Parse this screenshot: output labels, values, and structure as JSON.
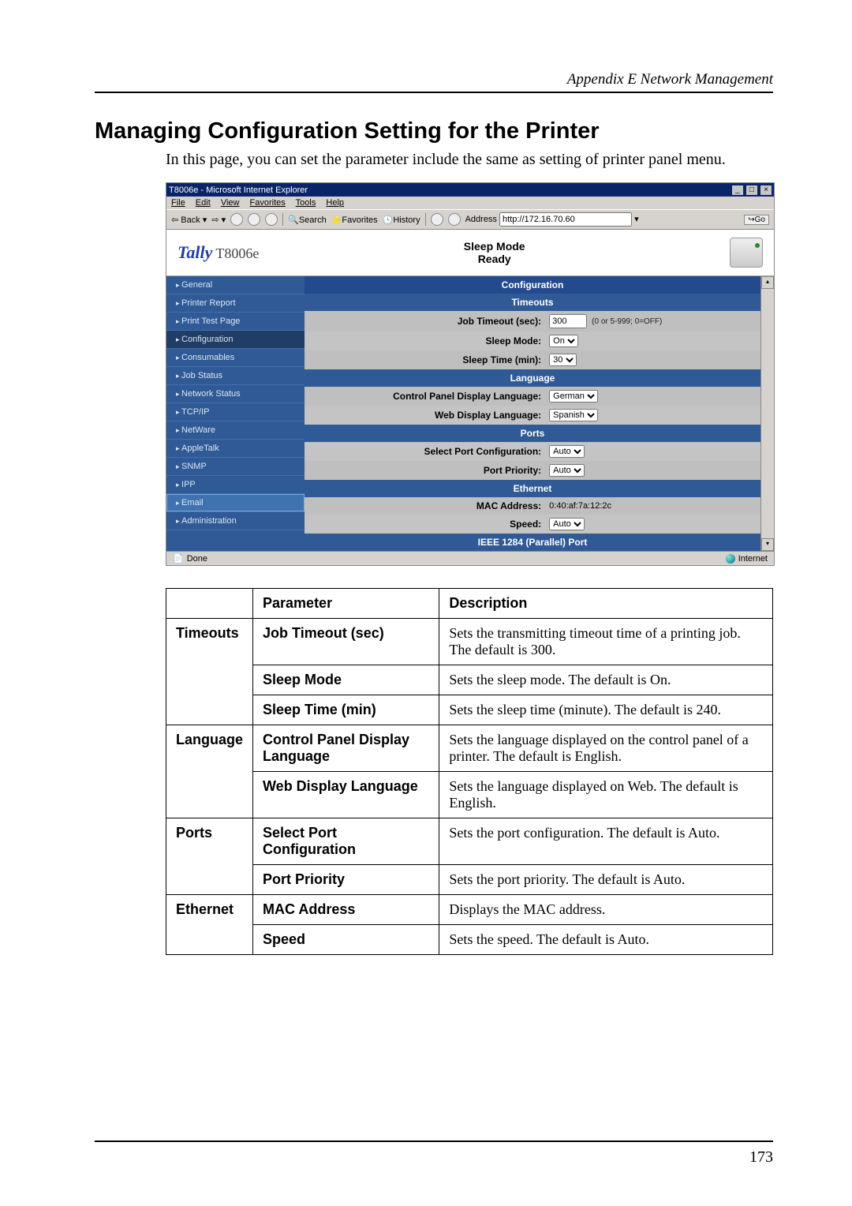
{
  "header": {
    "appendix": "Appendix E Network Management",
    "title": "Managing Configuration Setting for the Printer",
    "intro": "In this page, you can set the parameter include the same as setting of printer panel menu."
  },
  "page_number": "173",
  "screenshot": {
    "window_title": "T8006e - Microsoft Internet Explorer",
    "menus": [
      "File",
      "Edit",
      "View",
      "Favorites",
      "Tools",
      "Help"
    ],
    "toolbar": {
      "back": "Back",
      "search": "Search",
      "favorites": "Favorites",
      "history": "History",
      "address_label": "Address",
      "address_value": "http://172.16.70.60",
      "go": "Go"
    },
    "logo_brand": "Tally",
    "logo_model": "T8006e",
    "status_line1": "Sleep Mode",
    "status_line2": "Ready",
    "sidebar": [
      "General",
      "Printer Report",
      "Print Test Page",
      "Configuration",
      "Consumables",
      "Job Status",
      "Network Status",
      "TCP/IP",
      "NetWare",
      "AppleTalk",
      "SNMP",
      "IPP",
      "Email",
      "Administration"
    ],
    "groups": {
      "configuration": "Configuration",
      "timeouts": "Timeouts",
      "language": "Language",
      "ports": "Ports",
      "ethernet": "Ethernet",
      "parallel": "IEEE 1284 (Parallel) Port"
    },
    "fields": {
      "job_timeout_label": "Job Timeout (sec):",
      "job_timeout_value": "300",
      "job_timeout_hint": "(0 or 5-999; 0=OFF)",
      "sleep_mode_label": "Sleep Mode:",
      "sleep_mode_value": "On",
      "sleep_time_label": "Sleep Time (min):",
      "sleep_time_value": "30",
      "cp_lang_label": "Control Panel Display Language:",
      "cp_lang_value": "German",
      "web_lang_label": "Web Display Language:",
      "web_lang_value": "Spanish",
      "port_conf_label": "Select Port Configuration:",
      "port_conf_value": "Auto",
      "port_prio_label": "Port Priority:",
      "port_prio_value": "Auto",
      "mac_label": "MAC Address:",
      "mac_value": "0:40:af:7a:12:2c",
      "speed_label": "Speed:",
      "speed_value": "Auto"
    },
    "statusbar_left": "Done",
    "statusbar_right": "Internet"
  },
  "table": {
    "headers": {
      "group": "",
      "param": "Parameter",
      "desc": "Description"
    },
    "rows": [
      {
        "group": "Timeouts",
        "param": "Job Timeout (sec)",
        "desc": "Sets the transmitting timeout time of a printing job. The default is 300."
      },
      {
        "group": "",
        "param": "Sleep Mode",
        "desc": "Sets the sleep mode. The default is On."
      },
      {
        "group": "",
        "param": "Sleep Time (min)",
        "desc": "Sets the sleep time (minute). The default is 240."
      },
      {
        "group": "Language",
        "param": "Control Panel Display Language",
        "desc": "Sets the language displayed on the control panel of a printer. The default is English."
      },
      {
        "group": "",
        "param": "Web Display Language",
        "desc": "Sets the language displayed on Web. The default is English."
      },
      {
        "group": "Ports",
        "param": "Select Port Configuration",
        "desc": "Sets the port configuration. The default is Auto."
      },
      {
        "group": "",
        "param": "Port Priority",
        "desc": "Sets the port priority. The default is Auto."
      },
      {
        "group": "Ethernet",
        "param": "MAC Address",
        "desc": "Displays the MAC address."
      },
      {
        "group": "",
        "param": "Speed",
        "desc": "Sets the speed. The default is Auto."
      }
    ]
  }
}
